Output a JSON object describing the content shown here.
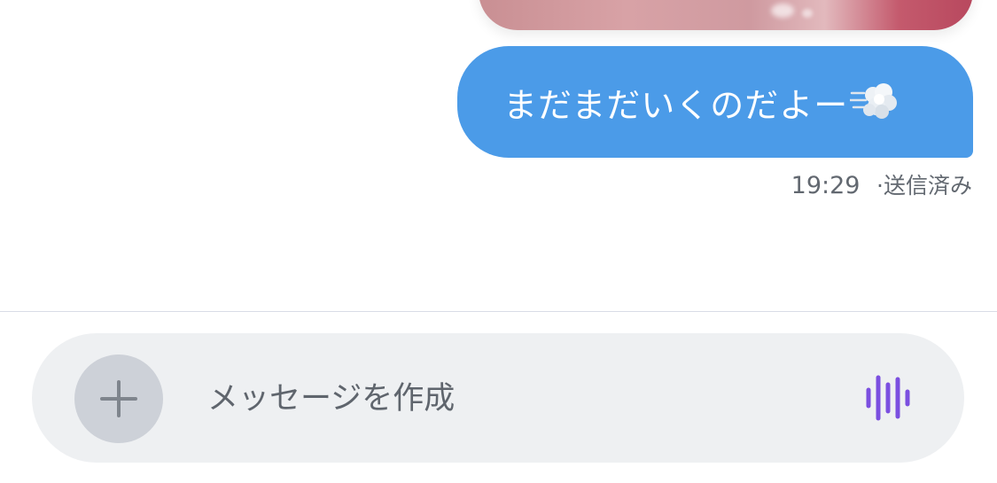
{
  "conversation": {
    "image_message": {
      "alt": ""
    },
    "sent_message": {
      "text": "まだまだいくのだよー",
      "emoji_icon": "dashing-away-icon",
      "bubble_color": "#4b9be8",
      "time": "19:29",
      "status": "·送信済み"
    }
  },
  "composer": {
    "add_icon": "plus-icon",
    "placeholder": "メッセージを作成",
    "voice_icon": "voice-waveform-icon",
    "voice_icon_color": "#7b4fe0",
    "background_color": "#eef0f2"
  }
}
